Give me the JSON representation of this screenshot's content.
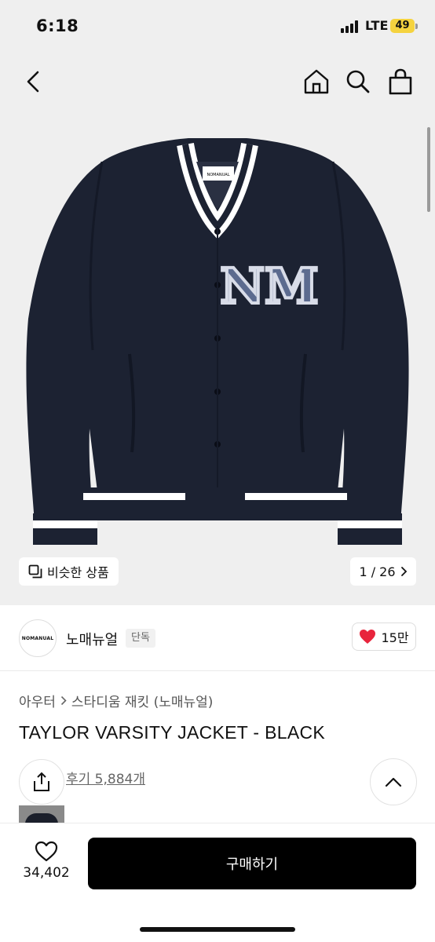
{
  "status_bar": {
    "time": "6:18",
    "network": "LTE",
    "battery": "49"
  },
  "nav": {
    "back_icon": "chevron-left-icon",
    "home_icon": "home-icon",
    "search_icon": "search-icon",
    "cart_icon": "shopping-bag-icon"
  },
  "product_image": {
    "similar_label": "비슷한 상품",
    "counter": "1 / 26",
    "patch_text": "NM",
    "tag_text": "NOMANUAL"
  },
  "brand": {
    "logo_text": "NOMANUAL",
    "name": "노매뉴얼",
    "badge": "단독",
    "likes": "15만"
  },
  "breadcrumb": {
    "category": "아우터",
    "subcategory": "스타디움 재킷 (노매뉴얼)"
  },
  "product": {
    "title": "TAYLOR VARSITY JACKET - BLACK",
    "reviews": "후기 5,884개"
  },
  "bottom": {
    "wish_count": "34,402",
    "buy_label": "구매하기"
  },
  "colors": {
    "accent": "#000000",
    "heart": "#e8243c",
    "battery": "#f5d33f"
  }
}
